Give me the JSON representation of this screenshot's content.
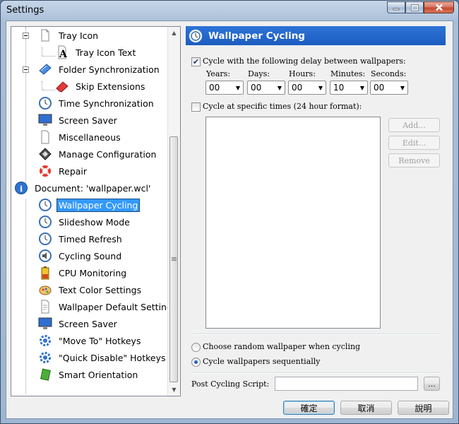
{
  "window": {
    "title": "Settings"
  },
  "tree": {
    "items": [
      {
        "label": "Tray Icon",
        "icon": "tray-icon"
      },
      {
        "label": "Tray Icon Text",
        "icon": "text-icon"
      },
      {
        "label": "Folder Synchronization",
        "icon": "folder-sync-icon"
      },
      {
        "label": "Skip Extensions",
        "icon": "eraser-icon"
      },
      {
        "label": "Time Synchronization",
        "icon": "clock-icon"
      },
      {
        "label": "Screen Saver",
        "icon": "monitor-icon"
      },
      {
        "label": "Miscellaneous",
        "icon": "document-icon"
      },
      {
        "label": "Manage Configuration",
        "icon": "config-icon"
      },
      {
        "label": "Repair",
        "icon": "lifebuoy-icon"
      },
      {
        "label": "Document: 'wallpaper.wcl'",
        "icon": "info-icon"
      },
      {
        "label": "Wallpaper Cycling",
        "icon": "clock-icon"
      },
      {
        "label": "Slideshow Mode",
        "icon": "clock-icon"
      },
      {
        "label": "Timed Refresh",
        "icon": "clock-icon"
      },
      {
        "label": "Cycling Sound",
        "icon": "sound-icon"
      },
      {
        "label": "CPU Monitoring",
        "icon": "battery-icon"
      },
      {
        "label": "Text Color Settings",
        "icon": "palette-icon"
      },
      {
        "label": "Wallpaper Default Settings",
        "icon": "document-icon"
      },
      {
        "label": "Screen Saver",
        "icon": "monitor-icon"
      },
      {
        "label": "\"Move To\" Hotkeys",
        "icon": "gear-icon"
      },
      {
        "label": "\"Quick Disable\" Hotkeys",
        "icon": "gear-icon"
      },
      {
        "label": "Smart Orientation",
        "icon": "rotate-icon"
      }
    ],
    "selected": "Wallpaper Cycling"
  },
  "panel": {
    "title": "Wallpaper Cycling",
    "cycle_delay": {
      "label": "Cycle with the following delay between wallpapers:",
      "checked": true
    },
    "fields": [
      {
        "label": "Years:",
        "value": "00"
      },
      {
        "label": "Days:",
        "value": "00"
      },
      {
        "label": "Hours:",
        "value": "00"
      },
      {
        "label": "Minutes:",
        "value": "10"
      },
      {
        "label": "Seconds:",
        "value": "00"
      }
    ],
    "cycle_times": {
      "label": "Cycle at specific times (24 hour format):",
      "checked": false
    },
    "buttons": {
      "add": "Add...",
      "edit": "Edit...",
      "remove": "Remove"
    },
    "radio_random": "Choose random wallpaper when cycling",
    "radio_sequential": "Cycle wallpapers sequentially",
    "post_script_label": "Post Cycling Script:",
    "post_script_value": "",
    "browse": "..."
  },
  "footer": {
    "ok": "確定",
    "cancel": "取消",
    "help": "說明"
  },
  "colors": {
    "header_blue": "#1c5cc0",
    "selection": "#3399ff"
  }
}
